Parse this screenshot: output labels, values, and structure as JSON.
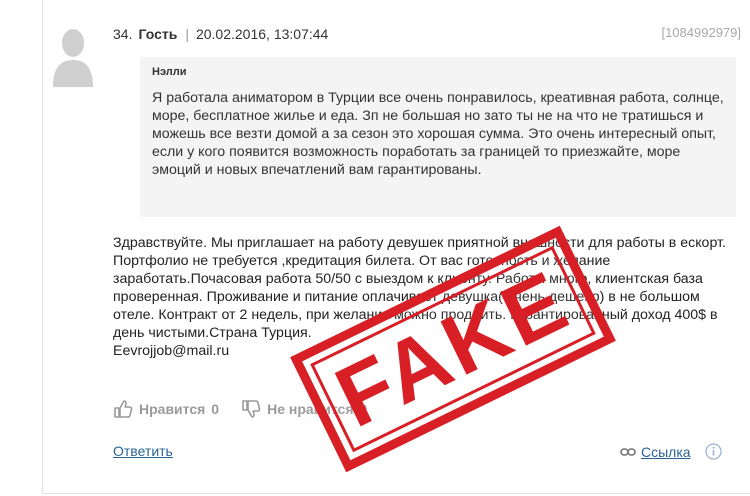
{
  "comment": {
    "number": "34.",
    "author": "Гость",
    "separator": "|",
    "datetime": "20.02.2016, 13:07:44",
    "id": "[1084992979]"
  },
  "quote": {
    "author": "Нэлли",
    "text": "Я работала аниматором в Турции все очень понравилось, креативная работа, солнце, море, бесплатное жилье и еда. Зп не большая но зато ты не на что не тратишься и можешь все везти домой а за сезон это хорошая сумма. Это очень интересный опыт, если у кого появится возможность поработать за границей то приезжайте, море эмоций и новых впечатлений вам гарантированы."
  },
  "body": {
    "text": "Здравствуйте. Мы приглашает на работу девушек приятной внешности для работы в ескорт. Портфолио не требуется ,кредитация билета. От вас готовность и желание заработать.Почасовая работа 50/50 с выездом к клиенту. Работы много, клиентская база проверенная. Проживание и питание оплачивает девушка( очень дешево) в не большом отеле. Контракт от 2 недель, при желании можно продлить. Гарантированный доход 400$ в день чистыми.Страна Турция.\nEevrojjob@mail.ru"
  },
  "actions": {
    "like_label": "Нравится",
    "like_count": "0",
    "dislike_label": "Не нравится",
    "dislike_count": "0",
    "reply_label": "Ответить",
    "link_label": "Ссылка"
  },
  "stamp": {
    "text": "FAKE",
    "color": "#d81f26"
  },
  "icons": {
    "avatar": "user-silhouette-icon",
    "like": "thumbs-up-icon",
    "dislike": "thumbs-down-icon",
    "link": "chain-link-icon",
    "info": "info-circle-icon"
  }
}
